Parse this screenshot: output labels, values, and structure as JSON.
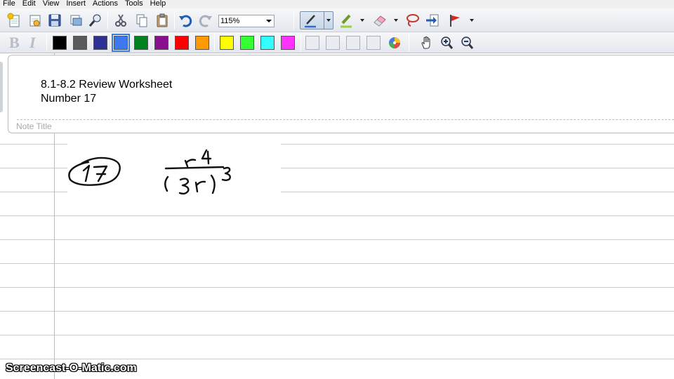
{
  "menu": [
    "File",
    "Edit",
    "View",
    "Insert",
    "Actions",
    "Tools",
    "Help"
  ],
  "toolbar": {
    "zoom_value": "115%",
    "icons": [
      "new-note-icon",
      "open-icon",
      "save-icon",
      "print-icon",
      "find-icon",
      "cut-icon",
      "copy-icon",
      "paste-icon",
      "undo-icon",
      "redo-icon",
      "pen-icon",
      "highlighter-icon",
      "eraser-icon",
      "lasso-icon",
      "insert-space-icon",
      "flag-icon"
    ]
  },
  "format": {
    "bold_label": "B",
    "italic_label": "I"
  },
  "palette": [
    "#000000",
    "#5a5a5a",
    "#2e3192",
    "#3c78f0",
    "#00821e",
    "#8a0f8f",
    "#ff0000",
    "#ff9900",
    "#ffff00",
    "#33ff33",
    "#33ffff",
    "#ff33ff"
  ],
  "selected_color": "#3c78f0",
  "note": {
    "title_line1": "8.1-8.2 Review Worksheet",
    "title_line2": "Number 17",
    "title_placeholder": "Note Title"
  },
  "ink": {
    "problem_number": "17",
    "expression": "r^4 / (3r)^3"
  },
  "watermark": "Screencast-O-Matic.com"
}
